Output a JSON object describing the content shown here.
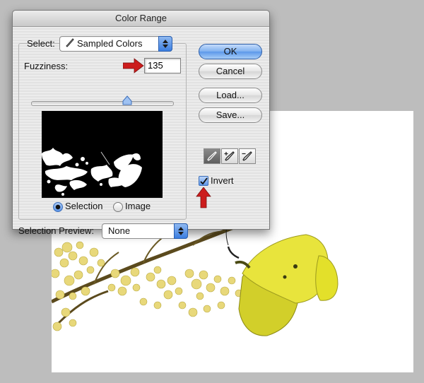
{
  "dialog": {
    "title": "Color Range",
    "select_label": "Select:",
    "select_value": "Sampled Colors",
    "fuzziness_label": "Fuzziness:",
    "fuzziness_value": "135",
    "radio_selection_label": "Selection",
    "radio_image_label": "Image",
    "selection_preview_label": "Selection Preview:",
    "selection_preview_value": "None",
    "invert_label": "Invert",
    "invert_checked": true,
    "mode_selected": "Selection"
  },
  "buttons": {
    "ok": "OK",
    "cancel": "Cancel",
    "load": "Load...",
    "save": "Save..."
  },
  "tools": [
    "eyedropper-icon",
    "eyedropper-plus-icon",
    "eyedropper-minus-icon"
  ],
  "colors": {
    "accent_blue": "#5c98ea",
    "annotation_red": "#cc1c1c",
    "butterfly_yellow": "#e3e02a"
  }
}
